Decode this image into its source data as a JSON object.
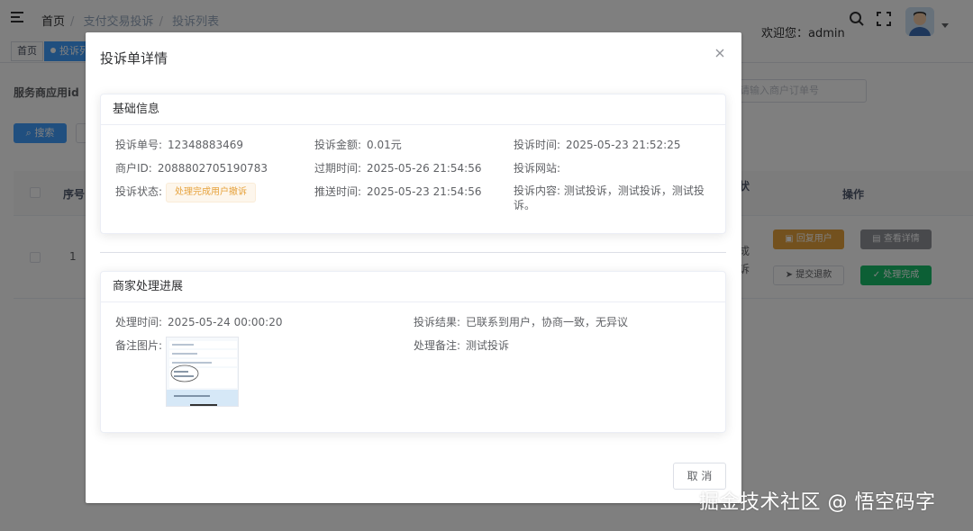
{
  "header": {
    "breadcrumbs": [
      "首页",
      "支付交易投诉",
      "投诉列表"
    ],
    "welcome": "欢迎您：admin",
    "icons": [
      "menu-fold-icon",
      "search-icon",
      "fullscreen-icon",
      "avatar",
      "chevron-down-icon"
    ]
  },
  "tags": {
    "home": "首页",
    "active": "投诉列"
  },
  "background": {
    "form_label": "服务商应用id",
    "search_placeholder": "请输入商户订单号",
    "search_button": "搜索",
    "table_headers": {
      "index": "序号",
      "status_partial": "状",
      "actions": "操作"
    },
    "row": {
      "index": "1",
      "frag1": "成",
      "frag2": "诉",
      "btn_reply_user": "回复用户",
      "btn_view_detail": "查看详情",
      "btn_submit_refund": "提交退款",
      "btn_done": "处理完成"
    }
  },
  "dialog": {
    "title": "投诉单详情",
    "basic": {
      "header": "基础信息",
      "complaint_no_label": "投诉单号:",
      "complaint_no": "12348883469",
      "amount_label": "投诉金额:",
      "amount": "0.01元",
      "time_label": "投诉时间:",
      "time": "2025-05-23 21:52:25",
      "merchant_label": "商户ID:",
      "merchant": "2088802705190783",
      "expire_label": "过期时间:",
      "expire": "2025-05-26 21:54:56",
      "site_label": "投诉网站:",
      "site": "",
      "status_label": "投诉状态:",
      "status": "处理完成用户撤诉",
      "push_label": "推送时间:",
      "push": "2025-05-23 21:54:56",
      "content_label": "投诉内容:",
      "content": "测试投诉，测试投诉，测试投诉。"
    },
    "progress": {
      "header": "商家处理进展",
      "handle_time_label": "处理时间:",
      "handle_time": "2025-05-24 00:00:20",
      "result_label": "投诉结果:",
      "result": "已联系到用户，协商一致，无异议",
      "image_label": "备注图片:",
      "remark_label": "处理备注:",
      "remark": "测试投诉"
    },
    "cancel": "取 消"
  },
  "watermark": "掘金技术社区 @ 悟空码字",
  "colors": {
    "primary": "#409eff",
    "warning": "#e6a23c",
    "success": "#19be6b",
    "info": "#909399"
  }
}
